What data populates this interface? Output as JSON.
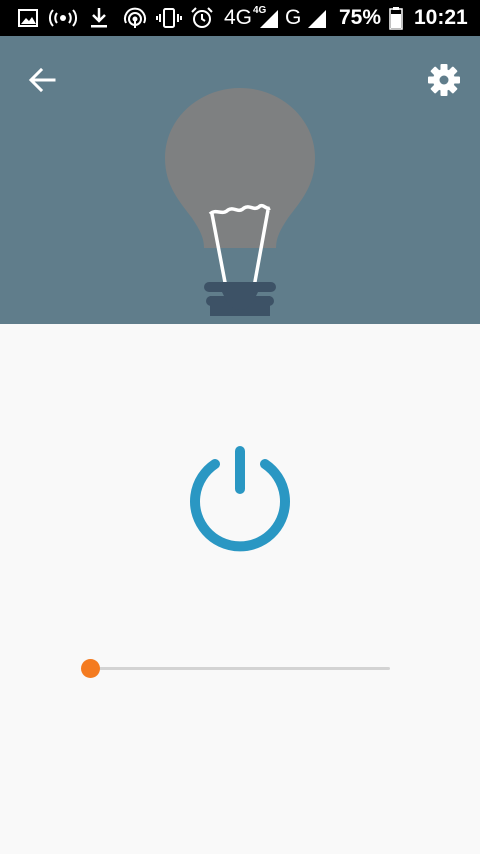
{
  "status_bar": {
    "network_type": "4G",
    "network_type_small": "4G",
    "network_secondary": "G",
    "battery_percent": "75%",
    "time": "10:21",
    "icons": [
      "image-icon",
      "hotspot-icon",
      "download-icon",
      "wireless-icon",
      "vibrate-icon",
      "alarm-icon",
      "signal-icon",
      "signal-icon",
      "battery-icon"
    ]
  },
  "header": {
    "background_color": "#607d8b",
    "back_icon": "arrow-left-icon",
    "settings_icon": "gear-icon",
    "bulb_icon": "light-bulb-icon"
  },
  "power": {
    "icon": "power-icon",
    "color": "#2a97c3"
  },
  "slider": {
    "value": 0,
    "track_color": "#d3d3d3",
    "thumb_color": "#f47b20"
  }
}
